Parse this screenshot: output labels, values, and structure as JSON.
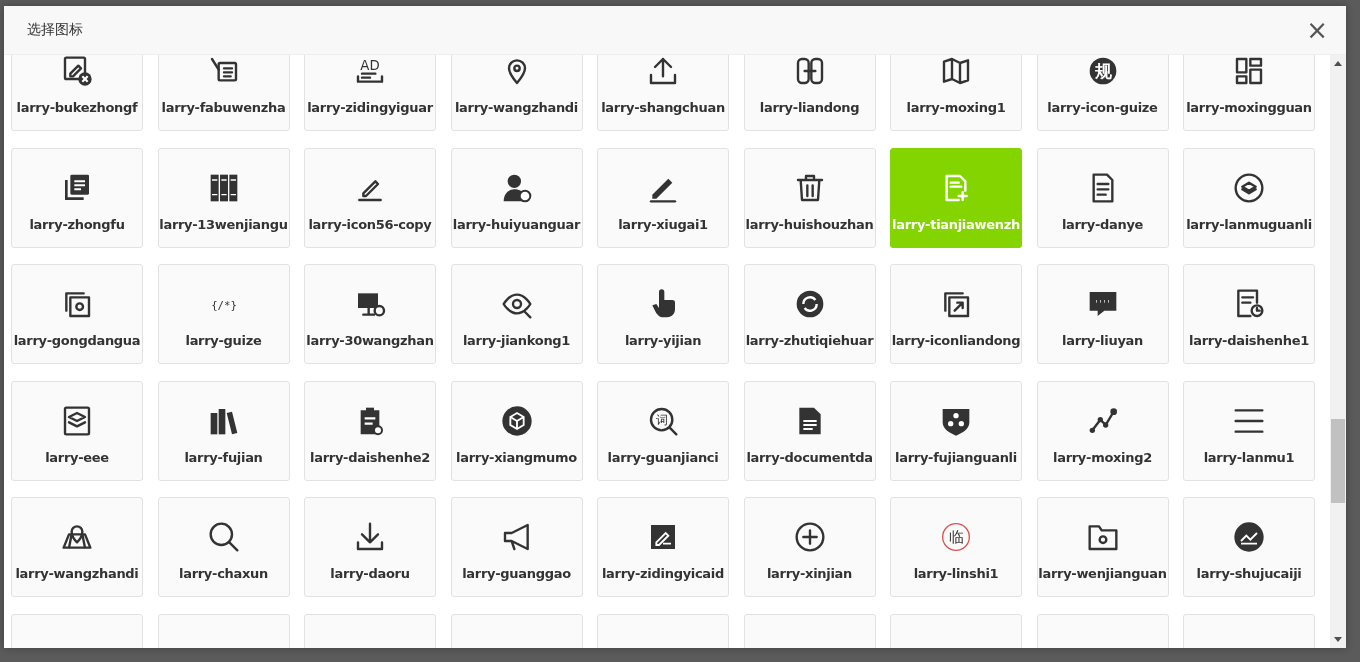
{
  "dialog": {
    "title": "选择图标",
    "close_label": "×"
  },
  "icons": [
    {
      "label": "larry-bukezhongf",
      "selected": false
    },
    {
      "label": "larry-fabuwenzha",
      "selected": false
    },
    {
      "label": "larry-zidingyiguar",
      "glyph": "AD",
      "selected": false
    },
    {
      "label": "larry-wangzhandi",
      "selected": false
    },
    {
      "label": "larry-shangchuan",
      "selected": false
    },
    {
      "label": "larry-liandong",
      "selected": false
    },
    {
      "label": "larry-moxing1",
      "selected": false
    },
    {
      "label": "larry-icon-guize",
      "glyph": "规",
      "selected": false
    },
    {
      "label": "larry-moxingguan",
      "selected": false
    },
    {
      "label": "larry-zhongfu",
      "selected": false
    },
    {
      "label": "larry-13wenjiangu",
      "selected": false
    },
    {
      "label": "larry-icon56-copy",
      "selected": false
    },
    {
      "label": "larry-huiyuanguar",
      "selected": false
    },
    {
      "label": "larry-xiugai1",
      "selected": false
    },
    {
      "label": "larry-huishouzhan",
      "selected": false
    },
    {
      "label": "larry-tianjiawenzh",
      "selected": true
    },
    {
      "label": "larry-danye",
      "selected": false
    },
    {
      "label": "larry-lanmuguanli",
      "selected": false
    },
    {
      "label": "larry-gongdangua",
      "selected": false
    },
    {
      "label": "larry-guize",
      "glyph": "{/*}",
      "selected": false
    },
    {
      "label": "larry-30wangzhan",
      "selected": false
    },
    {
      "label": "larry-jiankong1",
      "selected": false
    },
    {
      "label": "larry-yijian",
      "selected": false
    },
    {
      "label": "larry-zhutiqiehuar",
      "selected": false
    },
    {
      "label": "larry-iconliandong",
      "selected": false
    },
    {
      "label": "larry-liuyan",
      "selected": false
    },
    {
      "label": "larry-daishenhe1",
      "selected": false
    },
    {
      "label": "larry-eee",
      "selected": false
    },
    {
      "label": "larry-fujian",
      "selected": false
    },
    {
      "label": "larry-daishenhe2",
      "selected": false
    },
    {
      "label": "larry-xiangmumo",
      "selected": false
    },
    {
      "label": "larry-guanjianci",
      "glyph": "词",
      "selected": false
    },
    {
      "label": "larry-documentda",
      "selected": false
    },
    {
      "label": "larry-fujianguanli",
      "selected": false
    },
    {
      "label": "larry-moxing2",
      "selected": false
    },
    {
      "label": "larry-lanmu1",
      "selected": false
    },
    {
      "label": "larry-wangzhandi",
      "selected": false
    },
    {
      "label": "larry-chaxun",
      "selected": false
    },
    {
      "label": "larry-daoru",
      "selected": false
    },
    {
      "label": "larry-guanggao",
      "selected": false
    },
    {
      "label": "larry-zidingyicaid",
      "selected": false
    },
    {
      "label": "larry-xinjian",
      "selected": false
    },
    {
      "label": "larry-linshi1",
      "glyph": "临",
      "selected": false
    },
    {
      "label": "larry-wenjianguan",
      "selected": false
    },
    {
      "label": "larry-shujucaiji",
      "selected": false
    },
    {
      "selected": false
    },
    {
      "selected": false
    },
    {
      "selected": false
    },
    {
      "selected": false
    },
    {
      "selected": false
    },
    {
      "selected": false
    },
    {
      "selected": false
    },
    {
      "selected": false
    },
    {
      "selected": false
    }
  ]
}
